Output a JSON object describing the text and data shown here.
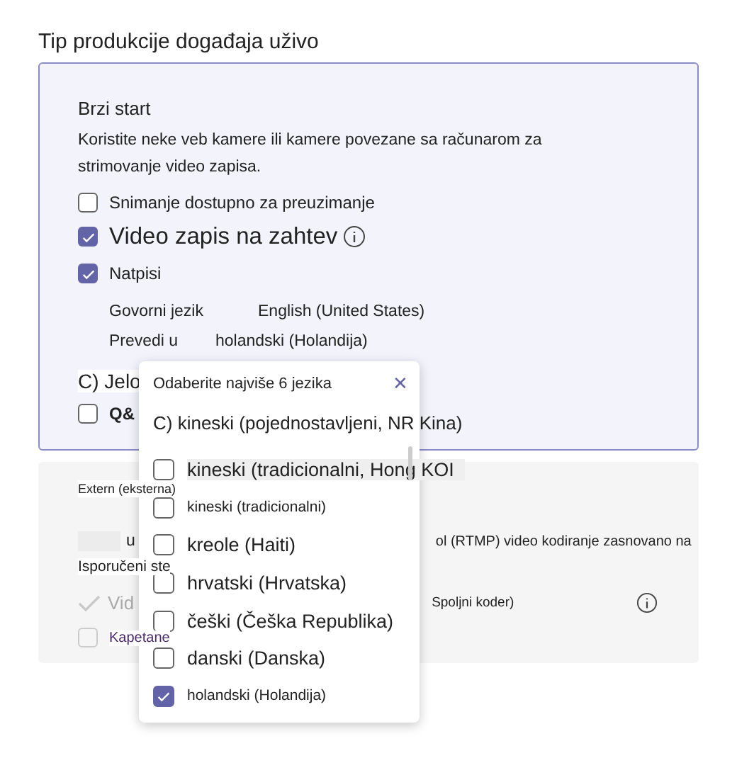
{
  "title": "Tip produkcije događaja uživo",
  "quick_start": {
    "heading": "Brzi start",
    "description": "Koristite neke veb kamere ili kamere povezane sa računarom za strimovanje video zapisa.",
    "options": [
      {
        "label": "Snimanje dostupno za preuzimanje",
        "checked": false,
        "large": false
      },
      {
        "label": "Video zapis na zahtev",
        "checked": true,
        "large": true,
        "info": true
      },
      {
        "label": "Natpisi",
        "checked": true,
        "large": false
      }
    ],
    "spoken_language": {
      "label": "Govorni jezik",
      "value": "English (United States)"
    },
    "translate_to": {
      "label": "Prevedi u",
      "value": "holandski (Holandija)"
    },
    "section_label": "C) Jelo",
    "qa": {
      "label": "Q&",
      "checked": false
    }
  },
  "external": {
    "heading": "Extern (eksterna)",
    "line_start": "u",
    "line_end": "ol (RTMP) video kodiranje zasnovano na",
    "delivered": "Isporučeni ste",
    "video": "Vid",
    "encoder": "Spoljni koder)",
    "captions": {
      "label": "Kapetane",
      "checked": false
    }
  },
  "language_popup": {
    "title": "Odaberite najviše 6 jezika",
    "close": "✕",
    "items": [
      {
        "kind": "header",
        "label": "C) kineski (pojednostavljeni, NR Kina)"
      },
      {
        "kind": "option",
        "label": "kineski (tradicionalni, Hong KOI",
        "checked": false,
        "large": true,
        "highlighted": true
      },
      {
        "kind": "option",
        "label": "kineski (tradicionalni)",
        "checked": false,
        "large": false,
        "highlighted": false
      },
      {
        "kind": "option",
        "label": "kreole (Haiti)",
        "checked": false,
        "large": true,
        "highlighted": false
      },
      {
        "kind": "option",
        "label": "hrvatski (Hrvatska)",
        "checked": false,
        "large": true,
        "highlighted": false
      },
      {
        "kind": "option",
        "label": "češki (Češka Republika)",
        "checked": false,
        "large": true,
        "highlighted": false
      },
      {
        "kind": "option",
        "label": "danski (Danska)",
        "checked": false,
        "large": true,
        "highlighted": false
      },
      {
        "kind": "option",
        "label": "holandski (Holandija)",
        "checked": true,
        "large": false,
        "highlighted": false
      }
    ]
  }
}
